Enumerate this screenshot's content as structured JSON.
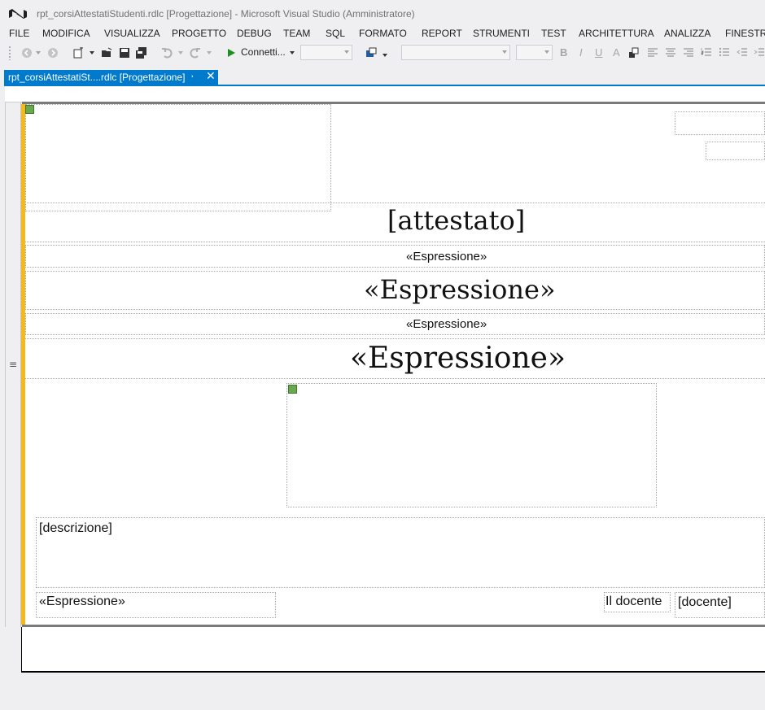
{
  "window": {
    "title": "rpt_corsiAttestatiStudenti.rdlc [Progettazione] - Microsoft Visual Studio (Amministratore)"
  },
  "menu": {
    "items": [
      "FILE",
      "MODIFICA",
      "VISUALIZZA",
      "PROGETTO",
      "DEBUG",
      "TEAM",
      "SQL",
      "FORMATO",
      "REPORT",
      "STRUMENTI",
      "TEST",
      "ARCHITETTURA",
      "ANALIZZA",
      "FINESTRA"
    ]
  },
  "toolbar": {
    "run_label": "Connetti...",
    "bold": "B",
    "italic": "I",
    "underline": "U",
    "font_color": "A"
  },
  "tabs": {
    "active_label": "rpt_corsiAttestatiSt....rdlc [Progettazione]"
  },
  "report": {
    "attestato": "[attestato]",
    "expr_small_1": "«Espressione»",
    "expr_large_1": "«Espressione»",
    "expr_small_2": "«Espressione»",
    "expr_large_2": "«Espressione»",
    "descrizione": "[descrizione]",
    "expr_footer": "«Espressione»",
    "il_docente": "Il docente",
    "docente": "[docente]"
  },
  "colors": {
    "accent": "#007acc",
    "selection_bar": "#f6b81a"
  }
}
